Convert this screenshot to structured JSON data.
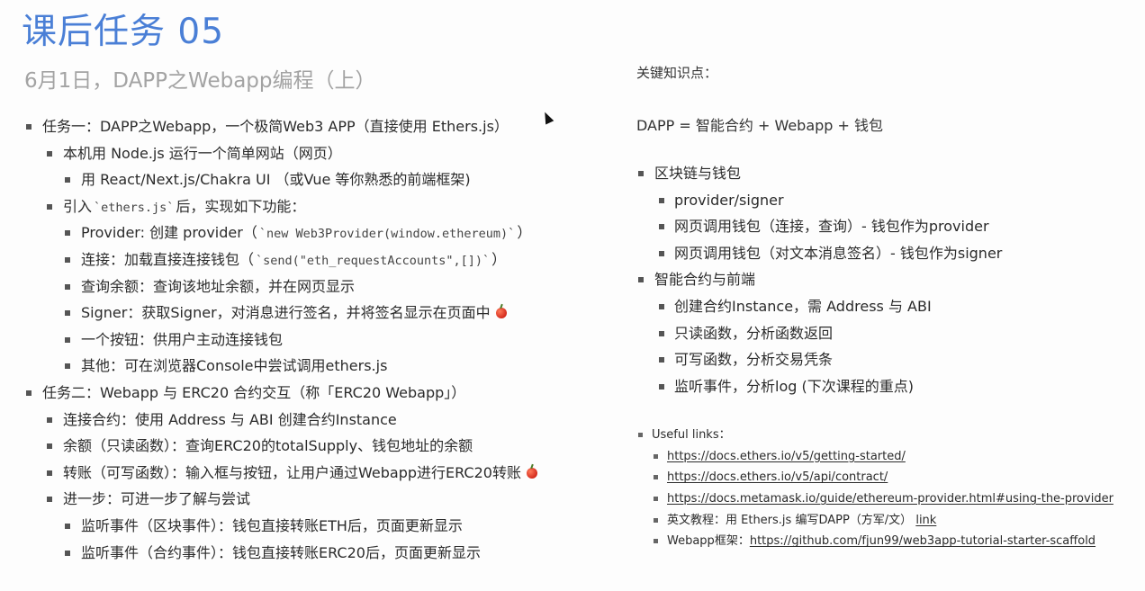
{
  "title": "课后任务 05",
  "subtitle": "6月1日，DAPP之Webapp编程（上）",
  "left": {
    "t1": "任务一：DAPP之Webapp，一个极简Web3 APP（直接使用 Ethers.js）",
    "t1a": "本机用 Node.js 运行一个简单网站（网页）",
    "t1a1": "用 React/Next.js/Chakra UI （或Vue 等你熟悉的前端框架)",
    "t1b_pre": "引入",
    "t1b_code": "`ethers.js`",
    "t1b_post": "后，实现如下功能：",
    "t1b1_pre": "Provider: 创建 provider（",
    "t1b1_code": "`new Web3Provider(window.ethereum)`",
    "t1b1_post": "）",
    "t1b2_pre": "连接：加载直接连接钱包（",
    "t1b2_code": "`send(\"eth_requestAccounts\",[])`",
    "t1b2_post": "）",
    "t1b3": "查询余额：查询该地址余额，并在网页显示",
    "t1b4": "Signer：获取Signer，对消息进行签名，并将签名显示在页面中",
    "t1b5": "一个按钮：供用户主动连接钱包",
    "t1b6": "其他：可在浏览器Console中尝试调用ethers.js",
    "t2": "任务二：Webapp 与 ERC20 合约交互（称「ERC20 Webapp」）",
    "t2a": "连接合约：使用 Address 与 ABI 创建合约Instance",
    "t2b": "余额（只读函数）：查询ERC20的totalSupply、钱包地址的余额",
    "t2c": "转账（可写函数）：输入框与按钮，让用户通过Webapp进行ERC20转账",
    "t2d": "进一步：可进一步了解与尝试",
    "t2d1": "监听事件（区块事件）：钱包直接转账ETH后，页面更新显示",
    "t2d2": "监听事件（合约事件）：钱包直接转账ERC20后，页面更新显示"
  },
  "right": {
    "kp_label": "关键知识点：",
    "dapp_eq": "DAPP = 智能合约 + Webapp + 钱包",
    "r1": "区块链与钱包",
    "r1a": "provider/signer",
    "r1b": "网页调用钱包（连接，查询）- 钱包作为provider",
    "r1c": "网页调用钱包（对文本消息签名）- 钱包作为signer",
    "r2": "智能合约与前端",
    "r2a": "创建合约Instance，需 Address 与 ABI",
    "r2b": "只读函数，分析函数返回",
    "r2c": "可写函数，分析交易凭条",
    "r2d": "监听事件，分析log (下次课程的重点)"
  },
  "links": {
    "label": "Useful links：",
    "l1": "https://docs.ethers.io/v5/getting-started/",
    "l2": "https://docs.ethers.io/v5/api/contract/",
    "l3": "https://docs.metamask.io/guide/ethereum-provider.html#using-the-provider",
    "l4_pre": "英文教程：用 Ethers.js 编写DAPP（方军/文）",
    "l4_link": "link",
    "l5_pre": "Webapp框架：",
    "l5_link": "https://github.com/fjun99/web3app-tutorial-starter-scaffold"
  },
  "icons": {
    "apple": "red-apple-icon",
    "cursor": "mouse-cursor-icon"
  },
  "colors": {
    "title": "#4a7fd6",
    "subtitle": "#a3a3a3"
  }
}
